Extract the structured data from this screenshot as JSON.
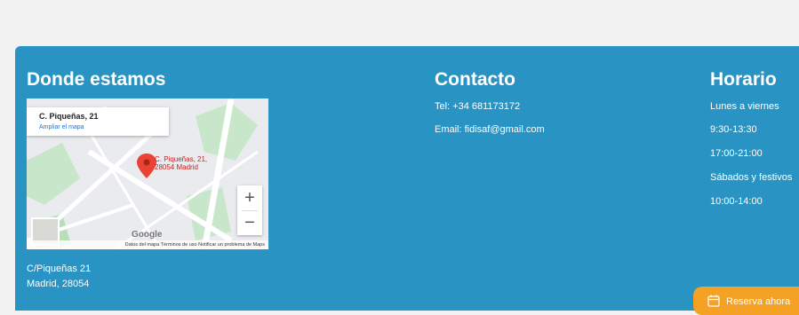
{
  "location": {
    "heading": "Donde estamos",
    "map": {
      "card_title": "C. Piqueñas, 21",
      "card_link": "Ampliar el mapa",
      "pin_label_line1": "C. Piqueñas, 21,",
      "pin_label_line2": "28054 Madrid",
      "zoom_in": "+",
      "zoom_out": "−",
      "brand": "Google",
      "footer": "Datos del mapa   Términos de uso   Notificar un problema de Maps"
    },
    "address_line1": "C/Piqueñas 21",
    "address_line2": "Madrid, 28054"
  },
  "contact": {
    "heading": "Contacto",
    "phone": "Tel: +34 681173172",
    "email": "Email: fidisaf@gmail.com"
  },
  "schedule": {
    "heading": "Horario",
    "items": [
      "Lunes a viernes",
      "9:30-13:30",
      "17:00-21:00",
      "Sábados y festivos",
      "10:00-14:00"
    ]
  },
  "cta": {
    "label": "Reserva ahora",
    "icon": "calendar-icon"
  },
  "colors": {
    "footer_bg": "#2994c3",
    "cta_bg": "#f5a124",
    "page_bg": "#f2f2f3"
  }
}
